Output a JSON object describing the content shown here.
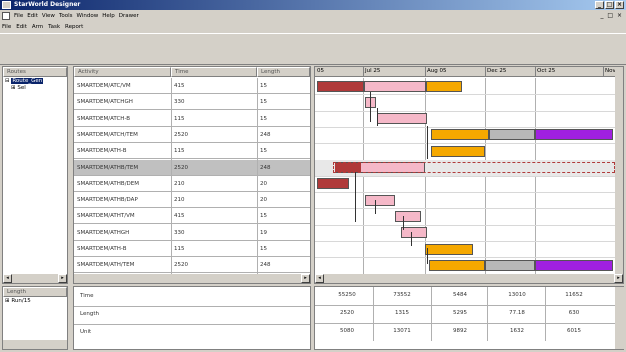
{
  "window": {
    "title": "StarWorld Designer"
  },
  "menu": [
    "File",
    "Edit",
    "View",
    "Tools",
    "Window",
    "Help",
    "Drawer"
  ],
  "menu2": [
    "File",
    "Edit",
    "Arm",
    "Task",
    "Report"
  ],
  "tree": {
    "header": "Routes",
    "items": [
      "Route_Gen",
      "Sel"
    ]
  },
  "tree2": {
    "header": "Length",
    "items": [
      "Run/15"
    ]
  },
  "table": {
    "headers": [
      "Activity",
      "Time",
      "Length"
    ],
    "rows": [
      {
        "activity": "SMARTDEM/ATC/VM",
        "time": "415",
        "length": "15"
      },
      {
        "activity": "SMARTDEM/ATCHGH",
        "time": "330",
        "length": "15"
      },
      {
        "activity": "SMARTDEM/ATCH-B",
        "time": "115",
        "length": "15"
      },
      {
        "activity": "SMARTDEM/ATCH/TEM",
        "time": "2520",
        "length": "248"
      },
      {
        "activity": "SMARTDEM/ATH-B",
        "time": "115",
        "length": "15"
      },
      {
        "activity": "SMARTDEM/ATHB/TEM",
        "time": "2520",
        "length": "248"
      },
      {
        "activity": "SMARTDEM/ATHB/DEM",
        "time": "210",
        "length": "20"
      },
      {
        "activity": "SMARTDEM/ATHB/DAP",
        "time": "210",
        "length": "20"
      },
      {
        "activity": "SMARTDEM/ATHT/VM",
        "time": "415",
        "length": "15"
      },
      {
        "activity": "SMARTDEM/ATHGH",
        "time": "330",
        "length": "19"
      },
      {
        "activity": "SMARTDEM/ATH-B",
        "time": "115",
        "length": "15"
      },
      {
        "activity": "SMARTDEM/ATH/TEM",
        "time": "2520",
        "length": "248"
      }
    ]
  },
  "timeline": {
    "labels": [
      "05",
      "Jul 25",
      "Aug 05",
      "Dec 25",
      "Oct 25",
      "Nov"
    ]
  },
  "bottom": {
    "rows": [
      "Time",
      "Length",
      "Unit"
    ],
    "values": [
      [
        "55250",
        "73552",
        "5484",
        "13010",
        "11652"
      ],
      [
        "2520",
        "1315",
        "5295",
        "77.18",
        "630"
      ],
      [
        "5080",
        "13071",
        "9892",
        "1632",
        "6015"
      ]
    ]
  },
  "colors": {
    "red": "#b03a3a",
    "pink": "#f5b8c8",
    "orange": "#f5a800",
    "gray": "#b8b8b8",
    "purple": "#a020e0"
  }
}
